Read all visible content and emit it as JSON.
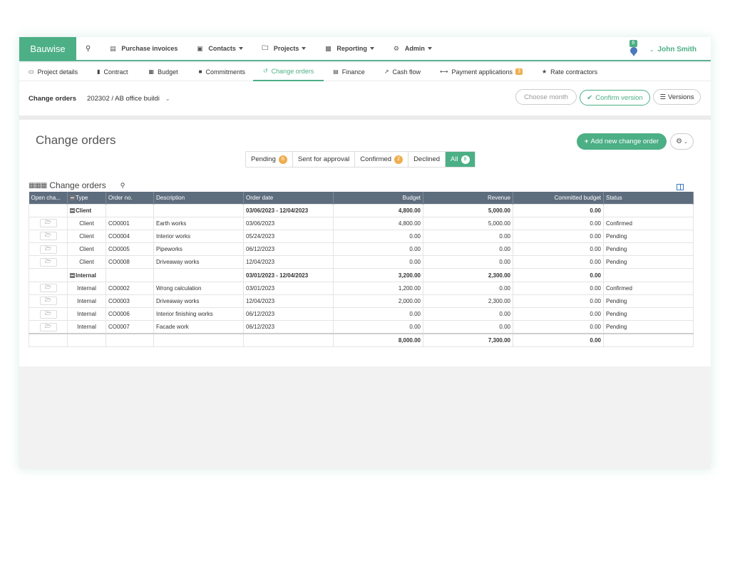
{
  "app": {
    "brand": "Bauwise"
  },
  "topnav": {
    "items": [
      {
        "label": "Purchase invoices",
        "icon": "book-icon"
      },
      {
        "label": "Contacts",
        "icon": "address-book-icon"
      },
      {
        "label": "Projects",
        "icon": "folder-icon"
      },
      {
        "label": "Reporting",
        "icon": "bar-chart-icon"
      },
      {
        "label": "Admin",
        "icon": "gear-icon"
      }
    ],
    "notification_count": "6",
    "user_name": "John Smith"
  },
  "subnav": {
    "items": [
      {
        "label": "Project details"
      },
      {
        "label": "Contract"
      },
      {
        "label": "Budget"
      },
      {
        "label": "Commitments"
      },
      {
        "label": "Change orders"
      },
      {
        "label": "Finance"
      },
      {
        "label": "Cash flow"
      },
      {
        "label": "Payment applications",
        "badge": "3"
      },
      {
        "label": "Rate contractors"
      }
    ]
  },
  "context": {
    "label": "Change orders",
    "project": "202302 / AB office buildi",
    "choose_month": "Choose month",
    "confirm_version": "Confirm version",
    "versions": "Versions"
  },
  "main": {
    "title": "Change orders",
    "add_button": "Add new change order",
    "filters": [
      {
        "label": "Pending",
        "count": "6"
      },
      {
        "label": "Sent for approval",
        "count": ""
      },
      {
        "label": "Confirmed",
        "count": "2"
      },
      {
        "label": "Declined",
        "count": ""
      },
      {
        "label": "All",
        "count": "8"
      }
    ],
    "grid_title": "Change orders"
  },
  "table": {
    "headers": [
      "Open cha...",
      "Type",
      "Order no.",
      "Description",
      "Order date",
      "Budget",
      "Revenue",
      "Committed budget",
      "Status"
    ],
    "groups": [
      {
        "name": "Client",
        "date_range": "03/06/2023 - 12/04/2023",
        "budget": "4,800.00",
        "revenue": "5,000.00",
        "committed": "0.00",
        "rows": [
          {
            "type": "Client",
            "order_no": "CO0001",
            "description": "Earth works",
            "order_date": "03/06/2023",
            "budget": "4,800.00",
            "revenue": "5,000.00",
            "committed": "0.00",
            "status": "Confirmed"
          },
          {
            "type": "Client",
            "order_no": "CO0004",
            "description": "Interior works",
            "order_date": "05/24/2023",
            "budget": "0.00",
            "revenue": "0.00",
            "committed": "0.00",
            "status": "Pending"
          },
          {
            "type": "Client",
            "order_no": "CO0005",
            "description": "Pipeworks",
            "order_date": "06/12/2023",
            "budget": "0.00",
            "revenue": "0.00",
            "committed": "0.00",
            "status": "Pending"
          },
          {
            "type": "Client",
            "order_no": "CO0008",
            "description": "Driveaway works",
            "order_date": "12/04/2023",
            "budget": "0.00",
            "revenue": "0.00",
            "committed": "0.00",
            "status": "Pending"
          }
        ]
      },
      {
        "name": "Internal",
        "date_range": "03/01/2023 - 12/04/2023",
        "budget": "3,200.00",
        "revenue": "2,300.00",
        "committed": "0.00",
        "rows": [
          {
            "type": "Internal",
            "order_no": "CO0002",
            "description": "Wrong calculation",
            "order_date": "03/01/2023",
            "budget": "1,200.00",
            "revenue": "0.00",
            "committed": "0.00",
            "status": "Confirmed"
          },
          {
            "type": "Internal",
            "order_no": "CO0003",
            "description": "Driveaway works",
            "order_date": "12/04/2023",
            "budget": "2,000.00",
            "revenue": "2,300.00",
            "committed": "0.00",
            "status": "Pending"
          },
          {
            "type": "Internal",
            "order_no": "CO0006",
            "description": "Interior finishing works",
            "order_date": "06/12/2023",
            "budget": "0.00",
            "revenue": "0.00",
            "committed": "0.00",
            "status": "Pending"
          },
          {
            "type": "Internal",
            "order_no": "CO0007",
            "description": "Facade work",
            "order_date": "06/12/2023",
            "budget": "0.00",
            "revenue": "0.00",
            "committed": "0.00",
            "status": "Pending"
          }
        ]
      }
    ],
    "totals": {
      "budget": "8,000.00",
      "revenue": "7,300.00",
      "committed": "0.00"
    }
  },
  "colors": {
    "accent": "#4caf86",
    "header": "#5d6d7e",
    "badge": "#f0ad4e"
  }
}
